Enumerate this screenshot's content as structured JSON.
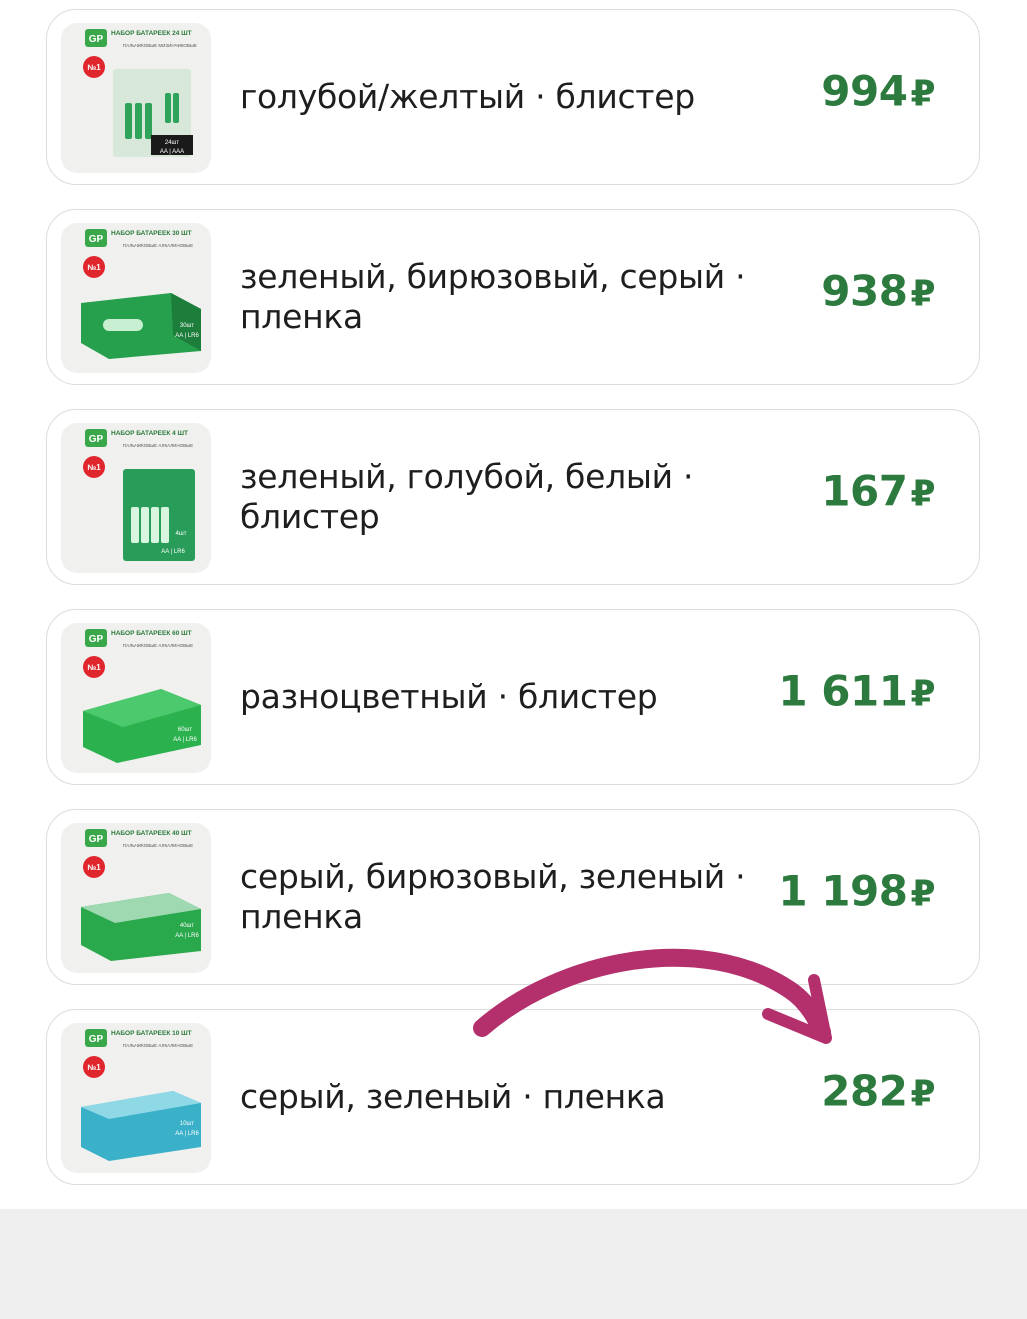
{
  "products": [
    {
      "title": "голубой/желтый · блистер",
      "price": "994",
      "currency": "₽",
      "pack_title": "НАБОР БАТАРЕЕК 24 ШТ",
      "pack_sub": "ПАЛЬЧИКОВЫЕ МИЗИНЧИКОВЫЕ",
      "pack_count": "24шт",
      "pack_type": "AA | AAA"
    },
    {
      "title": "зеленый, бирюзовый, серый · пленка",
      "price": "938",
      "currency": "₽",
      "pack_title": "НАБОР БАТАРЕЕК 30 ШТ",
      "pack_sub": "ПАЛЬЧИКОВЫЕ АЛКАЛИНОВЫЕ",
      "pack_count": "30шт",
      "pack_type": "AA | LR6"
    },
    {
      "title": "зеленый, голубой, белый · блистер",
      "price": "167",
      "currency": "₽",
      "pack_title": "НАБОР БАТАРЕЕК 4 ШТ",
      "pack_sub": "ПАЛЬЧИКОВЫЕ АЛКАЛИНОВЫЕ",
      "pack_count": "4шт",
      "pack_type": "AA | LR6"
    },
    {
      "title": "разноцветный · блистер",
      "price": "1 611",
      "currency": "₽",
      "pack_title": "НАБОР БАТАРЕЕК 60 ШТ",
      "pack_sub": "ПАЛЬЧИКОВЫЕ АЛКАЛИНОВЫЕ",
      "pack_count": "60шт",
      "pack_type": "AA | LR6"
    },
    {
      "title": "серый, бирюзовый, зеленый · пленка",
      "price": "1 198",
      "currency": "₽",
      "pack_title": "НАБОР БАТАРЕЕК 40 ШТ",
      "pack_sub": "ПАЛЬЧИКОВЫЕ АЛКАЛИНОВЫЕ",
      "pack_count": "40шт",
      "pack_type": "AA | LR6"
    },
    {
      "title": "серый, зеленый · пленка",
      "price": "282",
      "currency": "₽",
      "pack_title": "НАБОР БАТАРЕЕК 10 ШТ",
      "pack_sub": "ПАЛЬЧИКОВЫЕ АЛКАЛИНОВЫЕ",
      "pack_count": "10шт",
      "pack_type": "AA | LR6"
    }
  ],
  "brand_logo": "GP",
  "badge_text": "№1",
  "colors": {
    "price": "#2d7a3f",
    "arrow": "#b3306c",
    "brand_green": "#3aa84a",
    "badge_red": "#e0262d"
  }
}
